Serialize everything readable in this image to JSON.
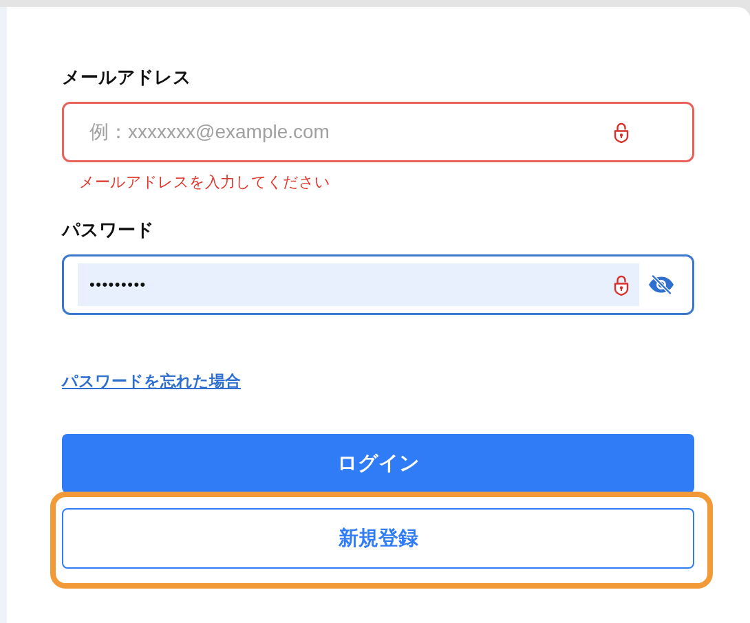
{
  "fields": [
    {
      "kind": "email",
      "label": "メールアドレス",
      "placeholder": "例：xxxxxxx@example.com",
      "error": "メールアドレスを入力してください",
      "invalid": true,
      "focused": false,
      "autofilled": false
    },
    {
      "kind": "password",
      "label": "パスワード",
      "value": "•••••••••",
      "invalid": false,
      "focused": true,
      "autofilled": true
    }
  ],
  "forgot_link": "パスワードを忘れた場合",
  "buttons": [
    {
      "kind": "primary",
      "label": "ログイン",
      "highlighted": false
    },
    {
      "kind": "secondary",
      "label": "新規登録",
      "highlighted": true
    }
  ]
}
